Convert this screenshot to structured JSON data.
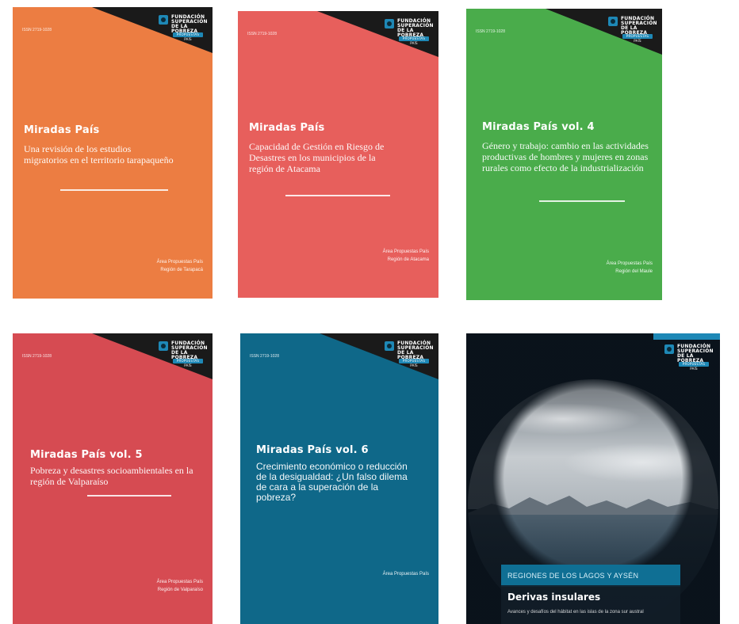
{
  "logo": {
    "text": "FUNDACIÓN SUPERACIÓN DE LA POBREZA",
    "tag": "PROPUESTAS PAÍS"
  },
  "covers": [
    {
      "id": "cover-1",
      "bg": "#ec7d42",
      "isbn": "ISSN 2719-1028",
      "series": "Miradas País",
      "subtitle": "Una revisión de los estudios migratorios en el territorio tarapaqueño",
      "area_line1": "Área Propuestas País",
      "area_line2": "Región de Tarapacá"
    },
    {
      "id": "cover-2",
      "bg": "#e75f5c",
      "isbn": "ISSN 2719-1028",
      "series": "Miradas País",
      "subtitle": "Capacidad de Gestión en Riesgo de Desastres en los municipios de la región de Atacama",
      "area_line1": "Área Propuestas País",
      "area_line2": "Región de Atacama"
    },
    {
      "id": "cover-3",
      "bg": "#4aac4b",
      "isbn": "ISSN 2719-1028",
      "series": "Miradas País vol. 4",
      "subtitle": "Género y trabajo: cambio en las actividades productivas de hombres y mujeres en zonas rurales como efecto de la industrialización",
      "area_line1": "Área Propuestas País",
      "area_line2": "Región del Maule"
    },
    {
      "id": "cover-4",
      "bg": "#d64b52",
      "isbn": "ISSN 2719-1028",
      "series": "Miradas País vol. 5",
      "subtitle": "Pobreza y desastres socioambientales en la región de Valparaíso",
      "area_line1": "Área Propuestas País",
      "area_line2": "Región de Valparaíso"
    },
    {
      "id": "cover-5",
      "bg": "#0f6889",
      "isbn": "ISSN 2719-1028",
      "series": "Miradas País vol. 6",
      "subtitle": "Crecimiento económico o reducción de la desigualdad: ¿Un falso dilema de cara a la superación de la pobreza?",
      "area_line1": "Área Propuestas País",
      "area_line2": ""
    },
    {
      "id": "cover-6",
      "bg": "#0d1620",
      "band": "REGIONES DE LOS LAGOS Y AYSÉN",
      "title": "Derivas insulares",
      "desc": "Avances y desafíos del hábitat en las islas de la zona sur austral"
    }
  ]
}
